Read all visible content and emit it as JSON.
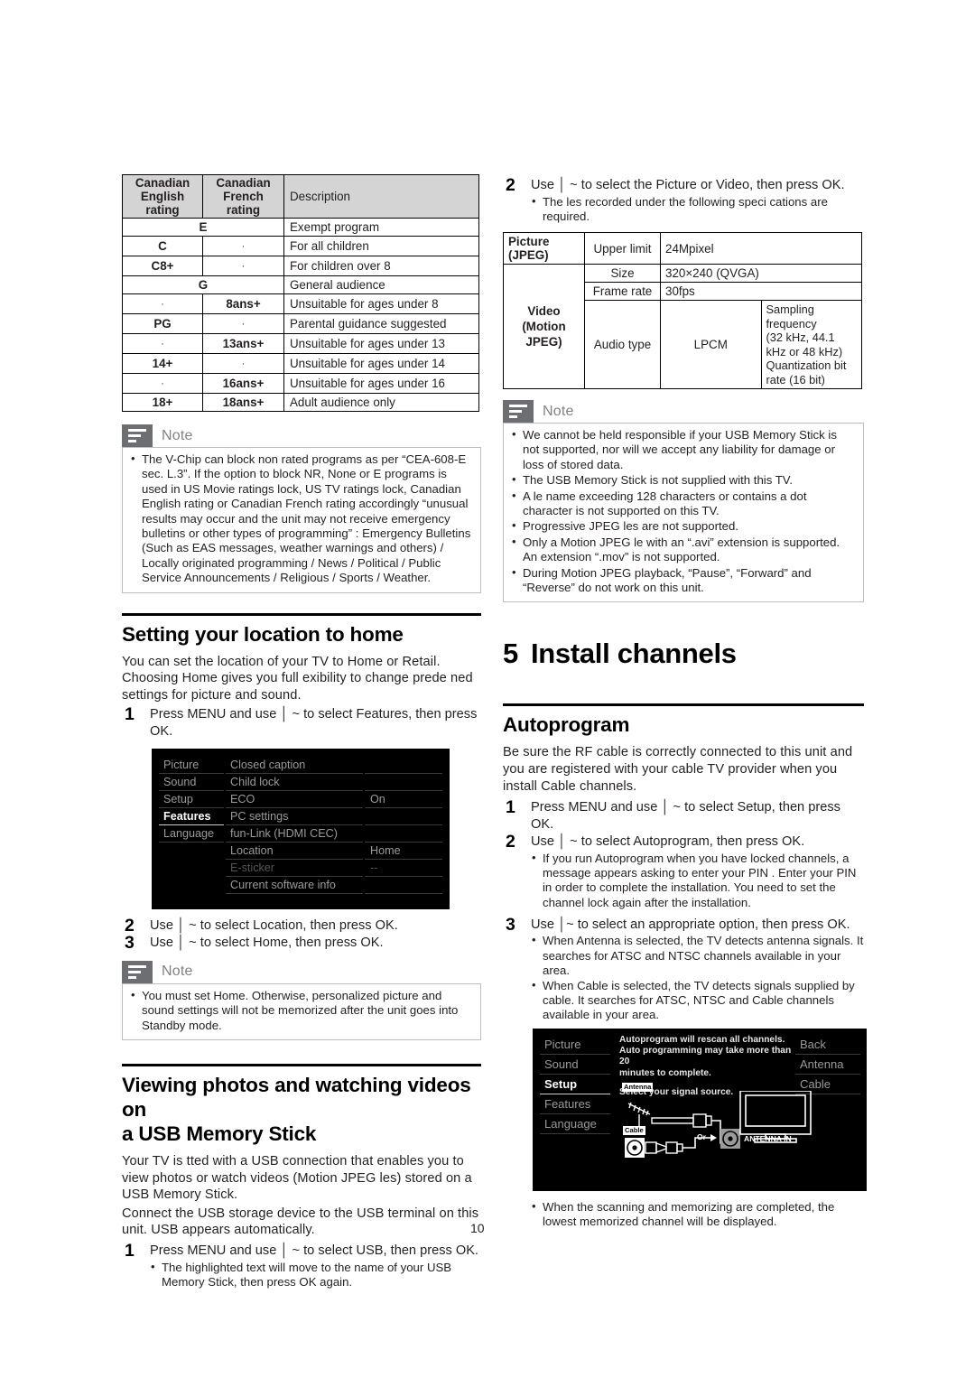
{
  "page": {
    "number": "10"
  },
  "ratings_table": {
    "headers": [
      "Canadian\nEnglish rating",
      "Canadian French rating",
      "Description"
    ],
    "header_en": "Canadian English rating",
    "header_en_l1": "Canadian",
    "header_en_l2": "English rating",
    "header_fr_l1": "Canadian",
    "header_fr_l2": "French rating",
    "header_desc": "Description",
    "rows": [
      {
        "span": true,
        "en": "E",
        "fr": "",
        "desc": "Exempt program"
      },
      {
        "span": false,
        "en": "C",
        "fr": "-",
        "desc": "For all children"
      },
      {
        "span": false,
        "en": "C8+",
        "fr": "-",
        "desc": "For children over 8"
      },
      {
        "span": true,
        "en": "G",
        "fr": "",
        "desc": "General audience"
      },
      {
        "span": false,
        "en": "-",
        "fr": "8ans+",
        "desc": "Unsuitable for ages under 8"
      },
      {
        "span": false,
        "en": "PG",
        "fr": "-",
        "desc": "Parental guidance suggested"
      },
      {
        "span": false,
        "en": "-",
        "fr": "13ans+",
        "desc": "Unsuitable for ages under 13"
      },
      {
        "span": false,
        "en": "14+",
        "fr": "-",
        "desc": "Unsuitable for ages under 14"
      },
      {
        "span": false,
        "en": "-",
        "fr": "16ans+",
        "desc": "Unsuitable for ages under 16"
      },
      {
        "span": false,
        "en": "18+",
        "fr": "18ans+",
        "desc": "Adult audience only"
      }
    ]
  },
  "note_vchip": {
    "title": "Note",
    "items": [
      "The V-Chip can block non rated programs as per “CEA-608-E sec. L.3”. If the option to block NR, None or E programs is used in US Movie ratings lock, US TV ratings lock, Canadian English rating or Canadian French rating accordingly “unusual results may occur and the unit may not receive emergency bulletins or other types of programming” : Emergency Bulletins (Such as EAS messages, weather warnings and others) / Locally originated programming / News / Political / Public Service Announcements / Religious / Sports / Weather."
    ]
  },
  "location_section": {
    "heading": "Setting your location to home",
    "intro": "You can set the location of your TV to Home or Retail. Choosing Home gives you full  exibility to change prede ned settings for picture and sound.",
    "step1_num": "1",
    "step1": "Press MENU and use │ ~ to select Features, then press OK.",
    "step2_num": "2",
    "step2": "Use │ ~ to select Location, then press OK.",
    "step3_num": "3",
    "step3": "Use │ ~ to select Home, then press OK."
  },
  "tv_menu_features": {
    "left_items": [
      "Picture",
      "Sound",
      "Setup",
      "Features",
      "Language"
    ],
    "selected_left": "Features",
    "mid_items": [
      "Closed caption",
      "Child lock",
      "ECO",
      "PC settings",
      "fun-Link (HDMI CEC)",
      "Location",
      "E-sticker",
      "Current software info"
    ],
    "disabled_mid": "E-sticker",
    "right_values": [
      "",
      "",
      "On",
      "",
      "",
      "Home",
      "--",
      ""
    ]
  },
  "note_home": {
    "title": "Note",
    "items": [
      "You must set Home. Otherwise, personalized picture and sound settings will not be memorized after the unit goes into Standby mode."
    ]
  },
  "usb_section": {
    "heading_l1": "Viewing photos and watching videos on",
    "heading_l2": "a USB Memory Stick",
    "para1": "Your TV is  tted with a USB connection that enables you to view photos or watch videos (Motion JPEG  les) stored on a USB Memory Stick.",
    "para2": "Connect the USB storage device to the USB terminal on this unit. USB appears automatically.",
    "step1_num": "1",
    "step1": "Press MENU and use │ ~ to select USB, then press OK.",
    "step1_bullets": [
      "The highlighted text will move to the name of your USB Memory Stick, then press OK again."
    ],
    "step2_num": "2",
    "step2": "Use │ ~ to select the Picture or Video, then press OK.",
    "step2_bullets": [
      "The  les recorded under the following speci cations are required."
    ]
  },
  "spec_table": {
    "rows": [
      {
        "label": "Picture (JPEG)",
        "item": "Upper limit",
        "value": "24Mpixel"
      },
      {
        "label": "Video (Motion JPEG)",
        "item": "Size",
        "value": "320×240 (QVGA)"
      },
      {
        "label": "",
        "item": "Frame rate",
        "value": "30fps"
      },
      {
        "label": "",
        "item": "Audio type",
        "value": "LPCM"
      }
    ],
    "video_label_l1": "Video",
    "video_label_l2": "(Motion JPEG)",
    "audio_codec": "LPCM",
    "audio_detail_l1": "Sampling frequency",
    "audio_detail_l2": "(32 kHz, 44.1 kHz or 48 kHz)",
    "audio_detail_l3": "Quantization bit rate (16 bit)"
  },
  "note_usb": {
    "title": "Note",
    "items": [
      "We cannot be held responsible if your USB Memory Stick is not supported, nor will we accept any liability for damage or loss of stored data.",
      "The USB Memory Stick is not supplied with this TV.",
      "A  le name exceeding 128 characters or contains a dot character is not supported on this TV.",
      "Progressive JPEG  les are not supported.",
      "Only a Motion JPEG  le with an “.avi” extension is supported. An extension “.mov” is not supported.",
      "During Motion JPEG playback, “Pause”, “Forward” and “Reverse” do not work on this unit."
    ]
  },
  "chapter": {
    "number": "5",
    "title": "Install channels"
  },
  "autoprogram": {
    "heading": "Autoprogram",
    "intro": "Be sure the RF cable is correctly connected to this unit and you are registered with your cable TV provider when you install Cable channels.",
    "step1_num": "1",
    "step1": "Press MENU and use │ ~ to select Setup, then press OK.",
    "step2_num": "2",
    "step2": "Use │ ~ to select Autoprogram, then press OK.",
    "step2_bullets": [
      "If you run Autoprogram when you have locked channels, a message appears asking to enter your PIN . Enter your PIN in order to complete the installation. You need to set the channel lock again after the installation."
    ],
    "step3_num": "3",
    "step3": "Use │~  to select an appropriate option, then press OK.",
    "step3_bullets": [
      "When Antenna is selected, the TV detects antenna signals. It searches for ATSC and NTSC channels available in your area.",
      "When Cable is selected, the TV detects signals supplied by cable. It searches for ATSC, NTSC and Cable channels available in your area."
    ],
    "final_bullets": [
      "When the scanning and memorizing are completed, the lowest memorized channel will be displayed."
    ]
  },
  "tv_menu_autoprogram": {
    "left_items": [
      "Picture",
      "Sound",
      "Setup",
      "Features",
      "Language"
    ],
    "selected_left": "Setup",
    "message_l1": "Autoprogram will rescan all channels.",
    "message_l2": "Auto programming  may take more than 20",
    "message_l3": "minutes to complete.",
    "prompt": "Select your signal source.",
    "right_items": [
      "Back",
      "Antenna",
      "Cable"
    ],
    "diagram_labels": {
      "antenna": "Antenna",
      "cable": "Cable",
      "or": "Or",
      "antenna_in": "ANTENNA IN"
    }
  },
  "colors": {
    "table_header_bg": "#d4d4d4",
    "note_icon_bg": "#6d6e71",
    "note_title": "#808285",
    "note_border": "#bcbec0",
    "text": "#231f20",
    "screen_bg": "#000000"
  }
}
